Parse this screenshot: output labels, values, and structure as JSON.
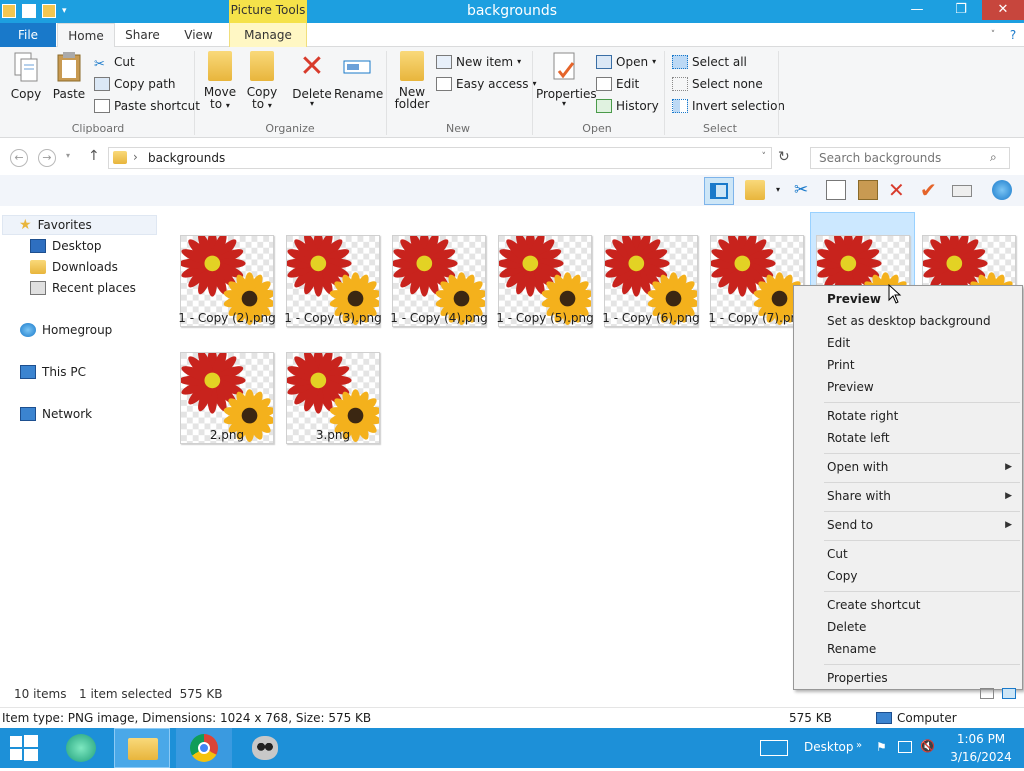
{
  "window": {
    "title": "backgrounds",
    "context_tab_header": "Picture Tools"
  },
  "tabs": [
    {
      "label": "File"
    },
    {
      "label": "Home"
    },
    {
      "label": "Share"
    },
    {
      "label": "View"
    },
    {
      "label": "Manage"
    }
  ],
  "ribbon": {
    "clipboard": {
      "copy": "Copy",
      "paste": "Paste",
      "cut": "Cut",
      "copy_path": "Copy path",
      "paste_shortcut": "Paste shortcut",
      "label": "Clipboard"
    },
    "organize": {
      "move_to": "Move",
      "move_to2": "to",
      "copy_to": "Copy",
      "copy_to2": "to",
      "delete": "Delete",
      "rename": "Rename",
      "label": "Organize"
    },
    "new": {
      "new_folder": "New",
      "new_folder2": "folder",
      "new_item": "New item",
      "easy_access": "Easy access",
      "label": "New"
    },
    "open": {
      "properties": "Properties",
      "open": "Open",
      "edit": "Edit",
      "history": "History",
      "label": "Open"
    },
    "select": {
      "select_all": "Select all",
      "select_none": "Select none",
      "invert": "Invert selection",
      "label": "Select"
    }
  },
  "address": {
    "path": "backgrounds",
    "search_placeholder": "Search backgrounds"
  },
  "nav": {
    "favorites": "Favorites",
    "desktop": "Desktop",
    "downloads": "Downloads",
    "recent": "Recent places",
    "homegroup": "Homegroup",
    "thispc": "This PC",
    "network": "Network"
  },
  "files": [
    {
      "name": "1 - Copy (2).png"
    },
    {
      "name": "1 - Copy (3).png"
    },
    {
      "name": "1 - Copy (4).png"
    },
    {
      "name": "1 - Copy (5).png"
    },
    {
      "name": "1 - Copy (6).png"
    },
    {
      "name": "1 - Copy (7).png"
    },
    {
      "name": ""
    },
    {
      "name": ""
    },
    {
      "name": "2.png"
    },
    {
      "name": "3.png"
    }
  ],
  "context_menu": {
    "preview_bold": "Preview",
    "set_bg": "Set as desktop background",
    "edit": "Edit",
    "print": "Print",
    "preview": "Preview",
    "rotate_right": "Rotate right",
    "rotate_left": "Rotate left",
    "open_with": "Open with",
    "share_with": "Share with",
    "send_to": "Send to",
    "cut": "Cut",
    "copy": "Copy",
    "create_shortcut": "Create shortcut",
    "delete": "Delete",
    "rename": "Rename",
    "properties": "Properties"
  },
  "status": {
    "items": "10 items",
    "selected": "1 item selected  575 KB"
  },
  "details": {
    "item_type": "Item type: PNG image, Dimensions: 1024 x 768, Size: 575 KB",
    "size": "575 KB",
    "location": "Computer"
  },
  "taskbar": {
    "desktop": "Desktop",
    "time": "1:06 PM",
    "date": "3/16/2024"
  },
  "colors": {
    "accent": "#1d9fe0",
    "taskbar": "#1d90d8",
    "selection": "#cce8ff"
  }
}
